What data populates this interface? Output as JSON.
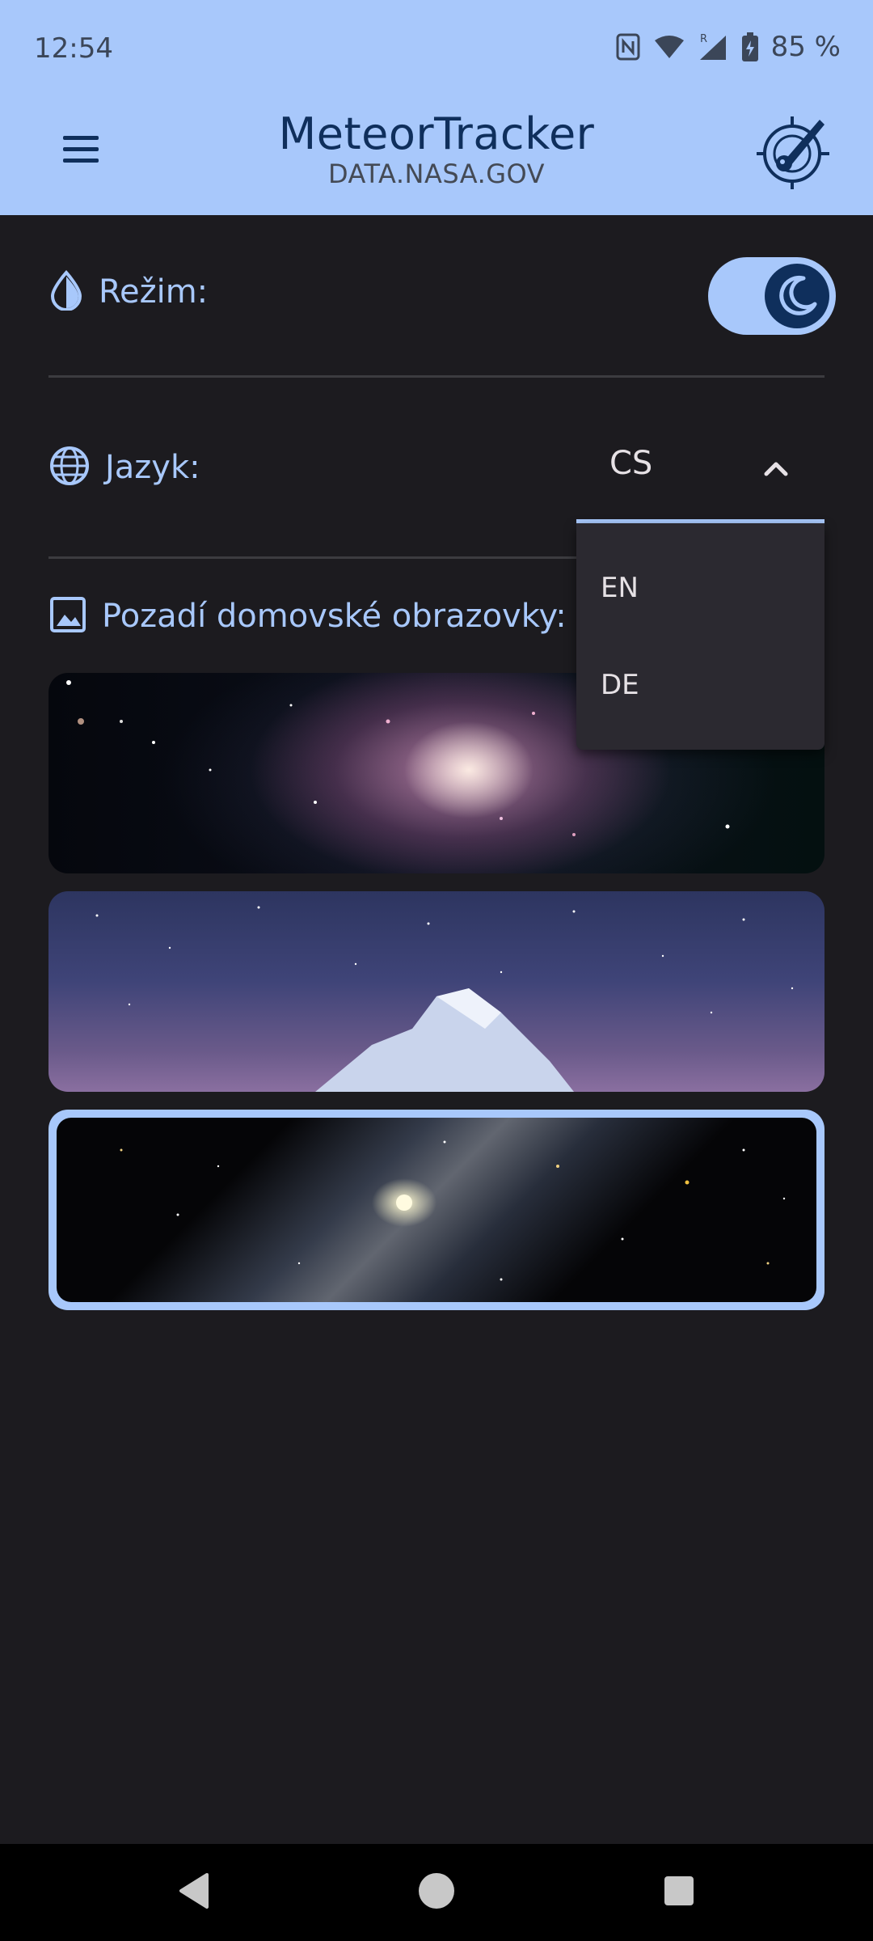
{
  "status_bar": {
    "time": "12:54",
    "battery": "85 %",
    "icons": [
      "nfc-icon",
      "wifi-icon",
      "signal-roaming-icon",
      "battery-charging-icon"
    ]
  },
  "header": {
    "title": "MeteorTracker",
    "subtitle": "DATA.NASA.GOV",
    "menu_icon": "hamburger-menu-icon",
    "logo_icon": "meteor-target-logo"
  },
  "settings": {
    "mode": {
      "label": "Režim:",
      "icon": "drop-icon",
      "toggle_icon": "moon-icon",
      "dark_mode_on": true
    },
    "language": {
      "label": "Jazyk:",
      "icon": "globe-icon",
      "selected": "CS",
      "expanded": true,
      "options": [
        "EN",
        "DE"
      ]
    },
    "wallpaper": {
      "label": "Pozadí domovské obrazovky:",
      "icon": "image-icon",
      "thumbnails": [
        {
          "name": "spiral-galaxy",
          "selected": false
        },
        {
          "name": "mountain-night-sky",
          "selected": false
        },
        {
          "name": "andromeda-galaxy",
          "selected": true
        }
      ]
    }
  },
  "colors": {
    "accent": "#a8c8fb",
    "header_bg": "#a8c8fb",
    "title": "#0f2f5c",
    "background": "#1c1b1f",
    "menu_bg": "#2b2930"
  },
  "navbar": {
    "icons": [
      "back-icon",
      "home-icon",
      "recents-icon"
    ]
  }
}
